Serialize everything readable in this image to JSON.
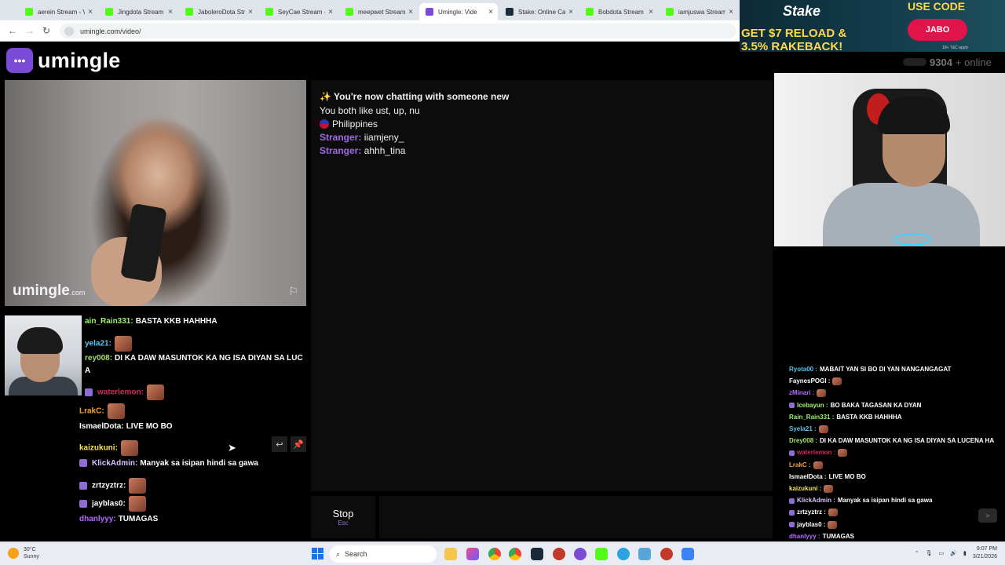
{
  "browser": {
    "tabs": [
      {
        "label": "aerein Stream - V",
        "color": "#53fc18",
        "active": false
      },
      {
        "label": "Jingdota Stream",
        "color": "#53fc18",
        "active": false
      },
      {
        "label": "JaboleroDota Str",
        "color": "#53fc18",
        "active": false
      },
      {
        "label": "SeyCae Stream -",
        "color": "#53fc18",
        "active": false
      },
      {
        "label": "meepwet Stream",
        "color": "#53fc18",
        "active": false
      },
      {
        "label": "Umingle: Vide",
        "color": "#7b4bd6",
        "active": true
      },
      {
        "label": "Stake: Online Ca",
        "color": "#1a2c38",
        "active": false
      },
      {
        "label": "Bobdota Stream",
        "color": "#53fc18",
        "active": false
      },
      {
        "label": "iamjuswa Stream",
        "color": "#53fc18",
        "active": false
      }
    ],
    "tab_close": "×",
    "url": "umingle.com/video/",
    "back": "←",
    "forward": "→",
    "reload": "↻"
  },
  "site": {
    "brand": "umingle",
    "logo_icon": "chat-bubble-icon",
    "watermark": "umingle",
    "watermark_suffix": ".com",
    "flag_icon": "⚐"
  },
  "chat": {
    "title": "✨ You're now chatting with someone new",
    "interests": "You both like ust, up, nu",
    "country": "Philippines",
    "messages": [
      {
        "sender": "Stranger:",
        "text": "iiamjeny_"
      },
      {
        "sender": "Stranger:",
        "text": "ahhh_tina"
      }
    ],
    "stop_label": "Stop",
    "stop_key": "Esc"
  },
  "left_overlay_chat": [
    {
      "user": "ain_Rain331:",
      "color": "#9cf26a",
      "text": "BASTA KKB HAHHHA",
      "emote": false,
      "badge": false
    },
    {
      "user": "yela21:",
      "color": "#59c3f0",
      "text": "",
      "emote": true,
      "badge": false
    },
    {
      "user": "rey008:",
      "color": "#a5e06b",
      "text": "DI KA DAW MASUNTOK KA NG ISA DIYAN SA LUC",
      "emote": false,
      "badge": false
    },
    {
      "user": "A",
      "color": "#ffffff",
      "text": "",
      "emote": false,
      "badge": false
    },
    {
      "user": "waterlemon:",
      "color": "#d6285a",
      "text": "",
      "emote": true,
      "badge": true
    },
    {
      "user": "LrakC:",
      "color": "#f5a13a",
      "text": "",
      "emote": true,
      "badge": false
    },
    {
      "user": "IsmaelDota:",
      "color": "#ffffff",
      "text": "LIVE MO BO",
      "emote": false,
      "badge": false
    },
    {
      "user": "kaizukuni:",
      "color": "#f6e25a",
      "text": "",
      "emote": true,
      "badge": false
    },
    {
      "user": "KlickAdmin:",
      "color": "#d6c3ff",
      "text": "Manyak sa isipan hindi sa gawa",
      "emote": false,
      "badge": true
    },
    {
      "user": "zrtzyztrz:",
      "color": "#ffffff",
      "text": "",
      "emote": true,
      "badge": true
    },
    {
      "user": "jayblas0:",
      "color": "#ffffff",
      "text": "",
      "emote": true,
      "badge": true
    },
    {
      "user": "dhanlyyy:",
      "color": "#b36bff",
      "text": "TUMAGAS",
      "emote": false,
      "badge": false
    }
  ],
  "ad": {
    "brand": "Stake",
    "line1": "GET $7 RELOAD &",
    "line2": "3.5% RAKEBACK!",
    "use_code": "USE CODE",
    "code": "JABO",
    "fine": "18+ T&C apply"
  },
  "online": {
    "count": "9304",
    "suffix": "+ online"
  },
  "right_stream_chat": [
    {
      "user": "Ryota00 :",
      "color": "#59c3f0",
      "text": "MABAIT YAN SI BO DI YAN NANGANGAGAT",
      "emote": false,
      "badge": false
    },
    {
      "user": "FaynesPOGI :",
      "color": "#ffffff",
      "text": "",
      "emote": true,
      "badge": false
    },
    {
      "user": "zMinari :",
      "color": "#b36bff",
      "text": "",
      "emote": true,
      "badge": false
    },
    {
      "user": "Icebayun :",
      "color": "#9cf26a",
      "text": "BO BAKA TAGASAN KA DYAN",
      "emote": false,
      "badge": true
    },
    {
      "user": "Rain_Rain331 :",
      "color": "#9cf26a",
      "text": "BASTA KKB HAHHHA",
      "emote": false,
      "badge": false
    },
    {
      "user": "Syela21 :",
      "color": "#59c3f0",
      "text": "",
      "emote": true,
      "badge": false
    },
    {
      "user": "Drey008 :",
      "color": "#a5e06b",
      "text": "DI KA DAW MASUNTOK KA NG ISA DIYAN SA LUCENA HA",
      "emote": false,
      "badge": false
    },
    {
      "user": "waterlemon :",
      "color": "#d6285a",
      "text": "",
      "emote": true,
      "badge": true
    },
    {
      "user": "LrakC :",
      "color": "#f5a13a",
      "text": "",
      "emote": true,
      "badge": false
    },
    {
      "user": "IsmaelDota :",
      "color": "#ffffff",
      "text": "LIVE MO BO",
      "emote": false,
      "badge": false
    },
    {
      "user": "kaizukuni :",
      "color": "#f6e25a",
      "text": "",
      "emote": true,
      "badge": false
    },
    {
      "user": "KlickAdmin :",
      "color": "#d6c3ff",
      "text": "Manyak sa isipan hindi sa gawa",
      "emote": false,
      "badge": true
    },
    {
      "user": "zrtzyztrz :",
      "color": "#ffffff",
      "text": "",
      "emote": true,
      "badge": true
    },
    {
      "user": "jayblas0 :",
      "color": "#ffffff",
      "text": "",
      "emote": true,
      "badge": true
    },
    {
      "user": "dhanlyyy :",
      "color": "#b36bff",
      "text": "TUMAGAS",
      "emote": false,
      "badge": false
    }
  ],
  "taskbar": {
    "temp": "30°C",
    "weather": "Sunny",
    "search_placeholder": "Search",
    "time": "9:07 PM",
    "date": "3/21/2026"
  }
}
